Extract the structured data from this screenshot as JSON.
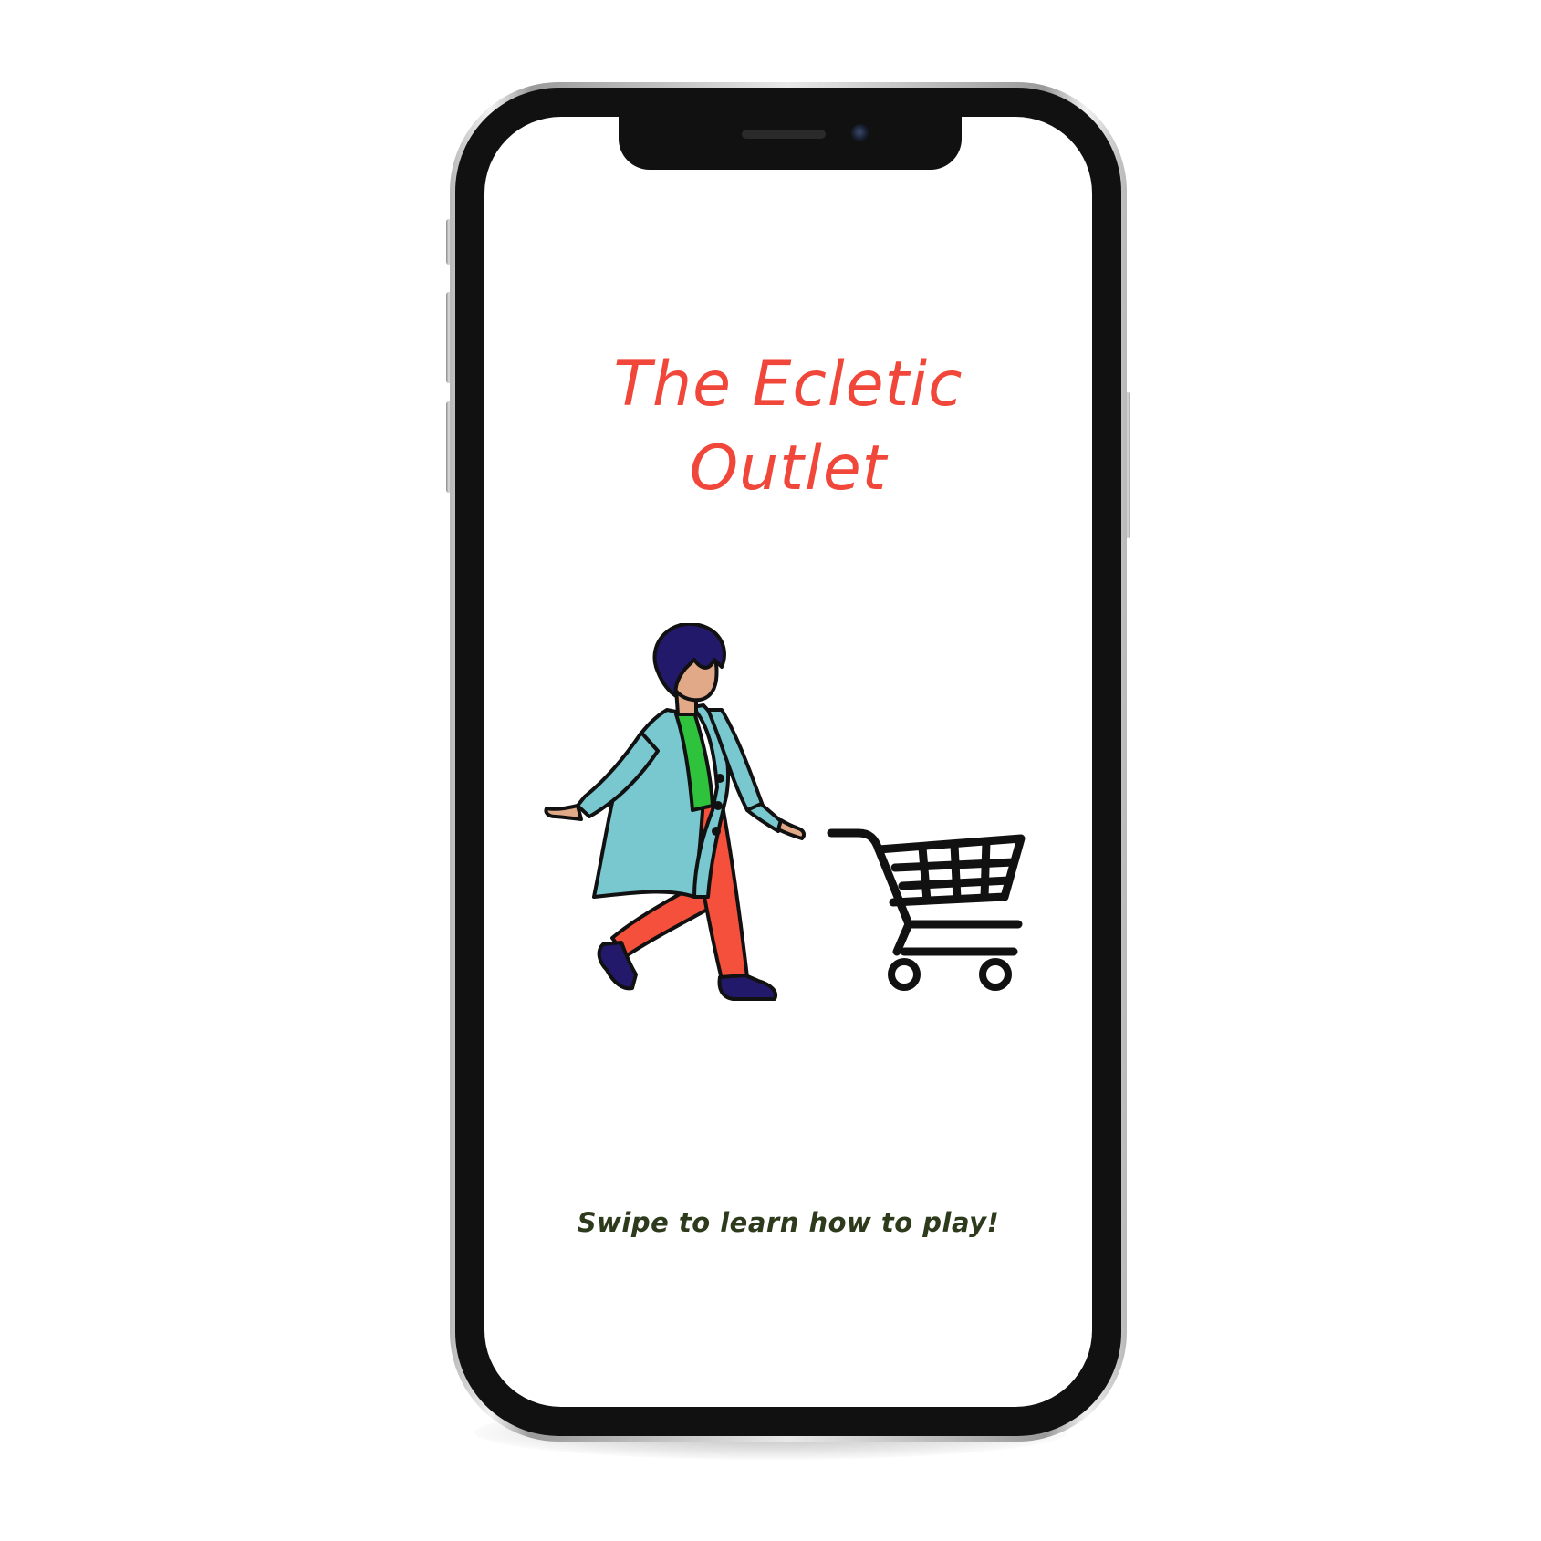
{
  "screen": {
    "title_line1": "The Ecletic",
    "title_line2": "Outlet",
    "swipe_hint": "Swipe to learn how to play!"
  },
  "colors": {
    "title": "#f0473a",
    "hint": "#2e3a1c",
    "coat": "#79c7cf",
    "pants": "#f4503b",
    "shirt": "#2fc23c",
    "hair": "#23196b",
    "skin": "#e2a988"
  },
  "illustration": {
    "icons": [
      "shopper-figure",
      "shopping-cart-icon"
    ]
  }
}
